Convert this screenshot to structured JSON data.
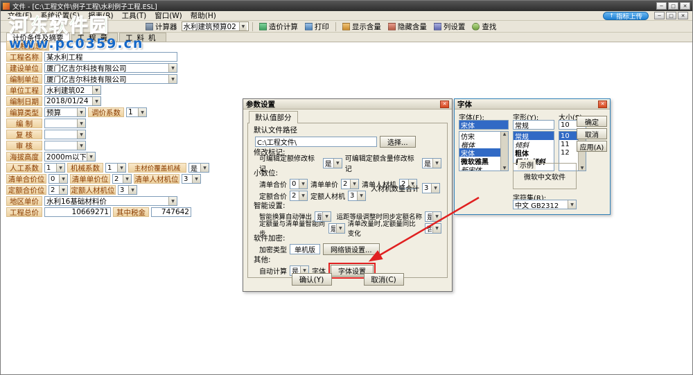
{
  "watermark": {
    "line1": "河东软件园",
    "line2": "www.pc0359.cn"
  },
  "window": {
    "title": "文件 - [C:\\工程文件\\例子工程\\水利例子工程.ESL]",
    "controls": {
      "minimize": "─",
      "restore": "□",
      "close": "✕"
    }
  },
  "menu": {
    "items": [
      "文件(F)",
      "系统设置(S)",
      "报表(R)",
      "工具(T)",
      "窗口(W)",
      "帮助(H)"
    ]
  },
  "header_actions": {
    "upload": "指标上传",
    "upload_icon": "↑"
  },
  "toolbar": {
    "calculator": "计算器",
    "template": "水利建筑预算02",
    "cost_calc": "造价计算",
    "print": "打印",
    "show_content": "显示含量",
    "hide_content": "隐藏含量",
    "columns": "列设置",
    "find": "查找"
  },
  "tabs": {
    "t1": "计价条件及摘要",
    "t2": "工程量",
    "t3": "工料机"
  },
  "form": {
    "section": "工程信息",
    "project_name_label": "工程名称",
    "project_name": "某水利工程",
    "build_unit_label": "建设单位",
    "build_unit": "厦门亿吉尔科技有限公司",
    "compile_unit_label": "编制单位",
    "compile_unit": "厦门亿吉尔科技有限公司",
    "unit_project_label": "单位工程",
    "unit_project": "水利建筑02",
    "compile_date_label": "编制日期",
    "compile_date": "2018/01/24",
    "calc_type_label": "编算类型",
    "calc_type": "预算",
    "adjust_factor_label": "调价系数",
    "adjust_factor": "1",
    "compiler_label": "编  制",
    "reviewer_label": "复  核",
    "auditor_label": "审  核",
    "altitude_label": "海拔高度",
    "altitude": "2000m以下",
    "labor_factor_label": "人工系数",
    "labor_factor": "1",
    "machine_factor_label": "机械系数",
    "machine_factor": "1",
    "material_cover_label": "主材价覆盖机械",
    "material_cover": "是",
    "list_total_label": "清单合价位",
    "list_total": "0",
    "list_unit_label": "清单单价位",
    "list_unit": "2",
    "list_res_label": "清单人材机位",
    "list_res": "3",
    "quota_total_label": "定额合价位",
    "quota_total": "2",
    "quota_res_label": "定额人材机位",
    "quota_res": "3",
    "region_price_label": "地区单价",
    "region_price": "水利16基础材料价",
    "total_label": "工程总价",
    "total": "10669271",
    "tax_label": "其中税金",
    "tax": "747642"
  },
  "params_dialog": {
    "title": "参数设置",
    "tab": "默认值部分",
    "path_label": "默认文件路径",
    "path_value": "C:\\工程文件\\",
    "browse_button": "选择...",
    "modify_section": "修改标记:",
    "modify_quota_label": "可编辑定额修改标记",
    "modify_quota": "是",
    "modify_content_label": "可编辑定额含量修改标记",
    "modify_content": "是",
    "decimal_section": "小数位:",
    "list_total_label": "清单合价",
    "list_total": "0",
    "list_unit_label": "清单单价",
    "list_unit": "2",
    "list_res_label": "清单人材机",
    "list_res": "2",
    "res_qty_label": "人材机数量合计",
    "res_qty": "3",
    "quota_total_label": "定额合价",
    "quota_total": "2",
    "quota_res_label": "定额人材机",
    "quota_res": "3",
    "smart_section": "智能设置:",
    "smart_calc_label": "智能换算自动弹出",
    "smart_calc": "是",
    "distance_label": "运距等级调整时同步定额名称",
    "distance_sync": "是",
    "qty_sync_label": "定额量与清单量智能同步",
    "qty_sync": "是",
    "qty_change_label": "清单改量时,定额量同比变化",
    "qty_change": "否",
    "lock_section": "软件加密:",
    "lock_type_label": "加密类型",
    "lock_type": "单机版",
    "net_lock_button": "网络锁设置...",
    "other_section": "其他:",
    "auto_calc_label": "自动计算",
    "auto_calc": "是",
    "font_label": "字体",
    "font_button": "字体设置",
    "ok_button": "确认(Y)",
    "cancel_button": "取消(C)"
  },
  "font_dialog": {
    "title": "字体",
    "family_label": "字体(F):",
    "family_value": "宋体",
    "family_list": [
      "仿宋",
      "楷体",
      "宋体",
      "微软雅黑",
      "新宋体"
    ],
    "style_label": "字形(Y):",
    "style_value": "常规",
    "style_list": [
      "常规",
      "倾斜",
      "粗体",
      "粗体 倾斜"
    ],
    "size_label": "大小(S):",
    "size_value": "10",
    "size_list": [
      "10",
      "11",
      "12"
    ],
    "ok_button": "确定",
    "cancel_button": "取消",
    "apply_button": "应用(A)",
    "sample_label": "示例",
    "sample_text": "微软中文软件",
    "charset_label": "字符集(R):",
    "charset_value": "中文 GB2312"
  }
}
